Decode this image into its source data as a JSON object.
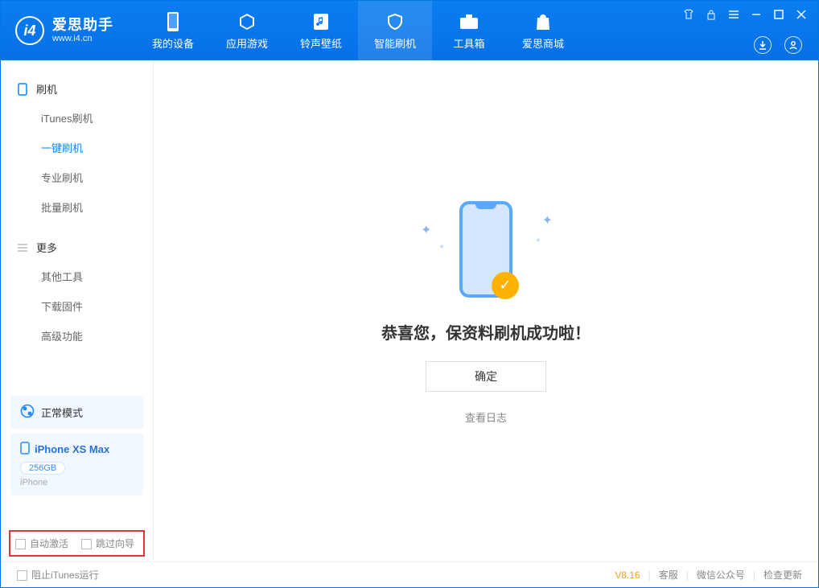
{
  "brand": {
    "name": "爱思助手",
    "url": "www.i4.cn"
  },
  "tabs": {
    "device": "我的设备",
    "apps": "应用游戏",
    "ring": "铃声壁纸",
    "flash": "智能刷机",
    "toolbox": "工具箱",
    "store": "爱思商城"
  },
  "sidebar": {
    "group_flash": "刷机",
    "items_flash": {
      "itunes": "iTunes刷机",
      "onekey": "一键刷机",
      "pro": "专业刷机",
      "batch": "批量刷机"
    },
    "group_more": "更多",
    "items_more": {
      "other": "其他工具",
      "firmware": "下载固件",
      "adv": "高级功能"
    }
  },
  "mode": {
    "label": "正常模式"
  },
  "device": {
    "name": "iPhone XS Max",
    "capacity": "256GB",
    "type": "iPhone"
  },
  "options": {
    "auto_activate": "自动激活",
    "skip_guide": "跳过向导"
  },
  "result": {
    "message": "恭喜您，保资料刷机成功啦！",
    "ok": "确定",
    "view_log": "查看日志"
  },
  "footer": {
    "block_itunes": "阻止iTunes运行",
    "version": "V8.16",
    "support": "客服",
    "wechat": "微信公众号",
    "update": "检查更新"
  }
}
